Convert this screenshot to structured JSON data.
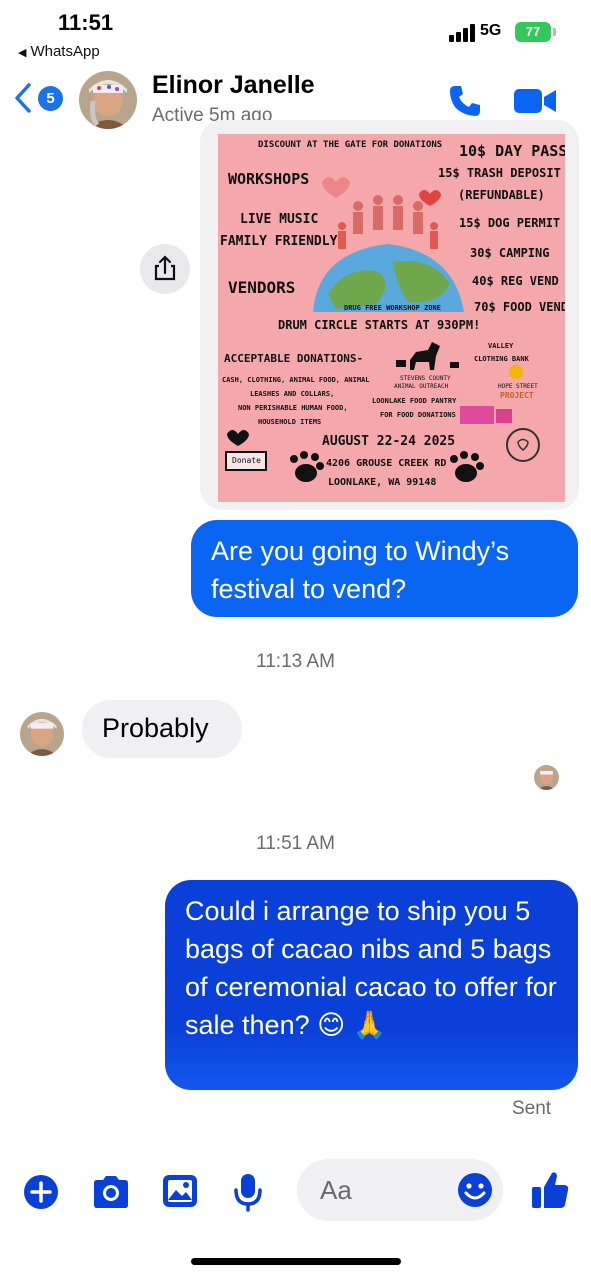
{
  "status_bar": {
    "time": "11:51",
    "back_app": "WhatsApp",
    "network": "5G",
    "battery": "77"
  },
  "header": {
    "back_count": "5",
    "contact_name": "Elinor Janelle",
    "status": "Active 5m ago",
    "accent_color": "#0a66f2"
  },
  "flyer": {
    "discount": "DISCOUNT AT THE GATE FOR DONATIONS",
    "day_pass": "10$ DAY PASS",
    "trash_deposit": "15$ TRASH DEPOSIT",
    "refundable": "(REFUNDABLE)",
    "dog_permit": "15$ DOG PERMIT",
    "camping": "30$ CAMPING",
    "reg_vend": "40$ REG VEND",
    "food_vend": "70$ FOOD VEND",
    "workshops": "WORKSHOPS",
    "live_music": "LIVE MUSIC",
    "family_friendly": "FAMILY FRIENDLY",
    "vendors": "VENDORS",
    "drug_free": "DRUG FREE WORKSHOP ZONE",
    "drum_circle": "DRUM CIRCLE STARTS AT 930PM!",
    "acceptable_donations": "ACCEPTABLE DONATIONS-",
    "donations_list": [
      "CASH, CLOTHING, ANIMAL FOOD, ANIMAL",
      "LEASHES AND COLLARS,",
      "NON PERISHABLE HUMAN FOOD,",
      "HOUSEHOLD ITEMS"
    ],
    "valley": "VALLEY",
    "clothing_bank": "CLOTHING BANK",
    "stevens_county": "STEVENS COUNTY",
    "animal_outreach": "ANIMAL OUTREACH",
    "hope_street": "HOPE STREET",
    "project": "PROJECT",
    "loonlake_pantry": "LOONLAKE FOOD PANTRY",
    "for_food_donations": "FOR FOOD DONATIONS",
    "donate": "Donate",
    "dates": "AUGUST 22-24 2025",
    "address": "4206 GROUSE CREEK RD",
    "city": "LOONLAKE, WA 99148"
  },
  "messages": [
    {
      "direction": "outgoing",
      "text": "Are you going to Windy’s festival to vend?"
    },
    {
      "timestamp": "11:13 AM"
    },
    {
      "direction": "incoming",
      "text": "Probably"
    },
    {
      "timestamp": "11:51 AM"
    },
    {
      "direction": "outgoing",
      "text": "Could i arrange to ship you 5 bags of cacao nibs and 5 bags of ceremonial cacao to offer for sale then? 😊 🙏"
    }
  ],
  "sent_label": "Sent",
  "composer": {
    "placeholder": "Aa"
  },
  "icons": [
    "plus-icon",
    "camera-icon",
    "gallery-icon",
    "microphone-icon",
    "emoji-icon",
    "thumbs-up-icon",
    "phone-icon",
    "video-icon",
    "share-icon"
  ]
}
